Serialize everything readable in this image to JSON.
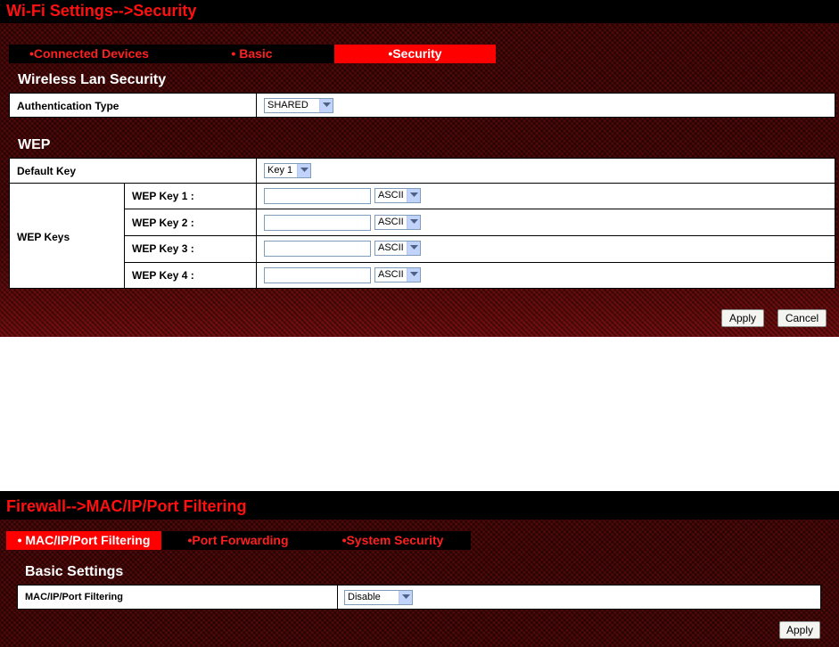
{
  "wifi": {
    "title": "Wi-Fi Settings-->Security",
    "tabs": [
      {
        "label": "•Connected Devices",
        "active": false
      },
      {
        "label": "• Basic",
        "active": false
      },
      {
        "label": "•Security",
        "active": true
      }
    ],
    "wireless_section": {
      "heading": "Wireless Lan Security",
      "auth_type_label": "Authentication Type",
      "auth_type_value": "SHARED"
    },
    "wep_section": {
      "heading": "WEP",
      "default_key_label": "Default Key",
      "default_key_value": "Key 1",
      "wep_keys_label": "WEP Keys",
      "keys": [
        {
          "label": "WEP Key 1 :",
          "value": "",
          "format": "ASCII"
        },
        {
          "label": "WEP Key 2 :",
          "value": "",
          "format": "ASCII"
        },
        {
          "label": "WEP Key 3 :",
          "value": "",
          "format": "ASCII"
        },
        {
          "label": "WEP Key 4 :",
          "value": "",
          "format": "ASCII"
        }
      ]
    },
    "buttons": {
      "apply": "Apply",
      "cancel": "Cancel"
    }
  },
  "firewall": {
    "title": "Firewall-->MAC/IP/Port Filtering",
    "tabs": [
      {
        "label": "• MAC/IP/Port Filtering",
        "active": true
      },
      {
        "label": "•Port Forwarding",
        "active": false
      },
      {
        "label": "•System Security",
        "active": false
      }
    ],
    "basic_section": {
      "heading": "Basic Settings",
      "filter_label": "MAC/IP/Port Filtering",
      "filter_value": "Disable"
    },
    "buttons": {
      "apply": "Apply"
    }
  },
  "colors": {
    "accent_red": "#ff0000",
    "title_red": "#ff1010",
    "panel_dark_red": "#3a0606"
  },
  "icons": {
    "select_arrow": "chevron-down-icon"
  }
}
